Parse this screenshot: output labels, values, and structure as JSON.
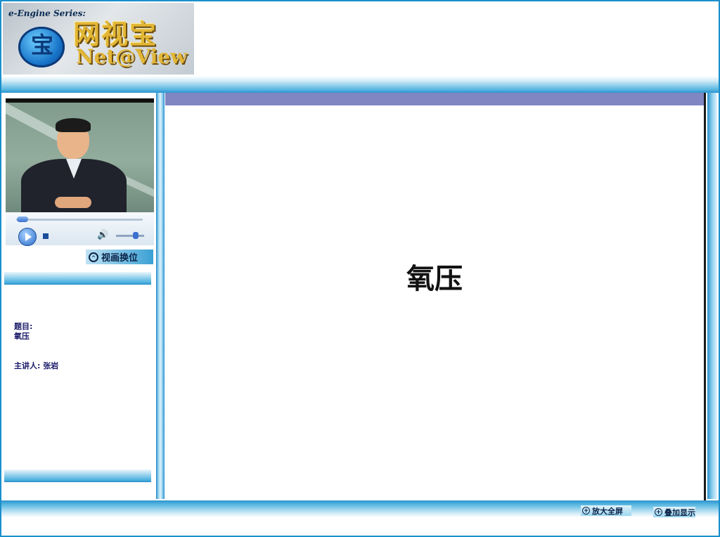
{
  "header": {
    "logo_series": "e-Engine Series:",
    "logo_cn": "网视宝",
    "logo_en": "Net@View",
    "logo_emblem_char": "宝"
  },
  "player": {
    "icons": {
      "play": "play-icon",
      "stop": "stop-icon",
      "volume": "volume-icon"
    },
    "volume_glyph": "🔊"
  },
  "sidebar": {
    "swap_button": "视画换位",
    "swap_icon_glyph": "⌃",
    "topic_label": "题目:",
    "topic_value": "氧压",
    "speaker_label": "主讲人:",
    "speaker_value": "张岩"
  },
  "slide": {
    "title": "氧压"
  },
  "bottom_buttons": {
    "fullscreen": "放大全屏",
    "overlay": "叠加显示",
    "plus_glyph": "+"
  },
  "colors": {
    "accent": "#2c94cf",
    "slide_header": "#7f86c2",
    "text_dark": "#1a1a6a"
  }
}
